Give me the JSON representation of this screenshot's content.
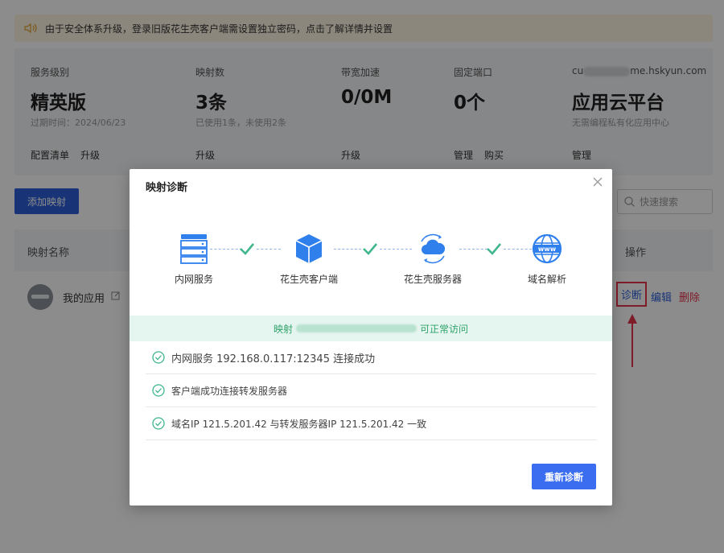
{
  "notice": {
    "text": "由于安全体系升级，登录旧版花生壳客户端需设置独立密码，点击了解详情并设置"
  },
  "stats": [
    {
      "label": "服务级别",
      "value": "精英版",
      "sub": "过期时间：2024/06/23",
      "actions": [
        "配置清单",
        "升级"
      ]
    },
    {
      "label": "映射数",
      "value": "3条",
      "sub": "已使用1条，未使用2条",
      "actions": [
        "升级"
      ]
    },
    {
      "label": "带宽加速",
      "value": "0/0M",
      "sub": "",
      "actions": [
        "升级"
      ]
    },
    {
      "label": "固定端口",
      "value": "0个",
      "sub": "",
      "actions": [
        "管理",
        "购买"
      ]
    },
    {
      "label_prefix": "cu",
      "label_suffix": "me.hskyun.com",
      "value": "应用云平台",
      "sub": "无需编程私有化应用中心",
      "actions": [
        "管理"
      ]
    }
  ],
  "toolbar": {
    "add_label": "添加映射",
    "search_placeholder": "快速搜索"
  },
  "table": {
    "headers": [
      "映射名称",
      "操作"
    ],
    "rows": [
      {
        "name": "我的应用",
        "actions": [
          "诊断",
          "编辑",
          "删除"
        ]
      }
    ]
  },
  "modal": {
    "title": "映射诊断",
    "nodes": [
      "内网服务",
      "花生壳客户端",
      "花生壳服务器",
      "域名解析"
    ],
    "www_label": "www",
    "banner_prefix": "映射",
    "banner_suffix": "可正常访问",
    "checks": [
      "内网服务 192.168.0.117:12345 连接成功",
      "客户端成功连接转发服务器",
      "域名IP 121.5.201.42 与转发服务器IP 121.5.201.42 一致"
    ],
    "retry_label": "重新诊断"
  },
  "colors": {
    "primary": "#2d5fd9",
    "danger": "#e8344c",
    "success": "#2fa36b"
  }
}
